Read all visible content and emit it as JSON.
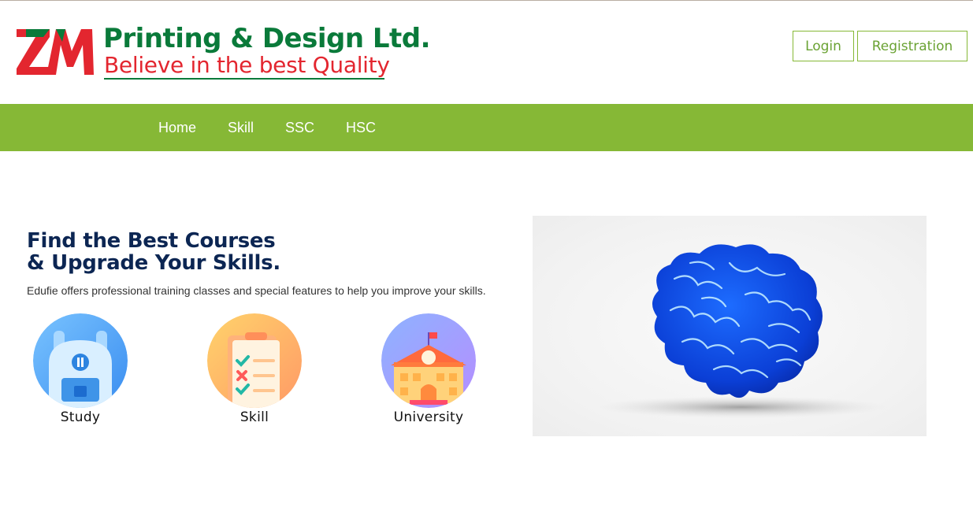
{
  "brand": {
    "logo_mark": "ZM",
    "name": "Printing & Design Ltd.",
    "tagline": "Believe in the best Quality"
  },
  "auth": {
    "login_label": "Login",
    "registration_label": "Registration"
  },
  "nav": {
    "items": [
      {
        "label": "Home"
      },
      {
        "label": "Skill"
      },
      {
        "label": "SSC"
      },
      {
        "label": "HSC"
      }
    ]
  },
  "hero": {
    "title_line1": "Find the Best Courses",
    "title_line2": "& Upgrade Your Skills.",
    "description": "Edufie offers professional training classes and special features to help you improve your skills.",
    "image_icon": "brain-icon"
  },
  "features": [
    {
      "label": "Study",
      "icon": "backpack-icon"
    },
    {
      "label": "Skill",
      "icon": "checklist-icon"
    },
    {
      "label": "University",
      "icon": "university-building-icon"
    }
  ],
  "colors": {
    "brand_green": "#0a7a3a",
    "brand_red": "#e3262f",
    "nav_green": "#86b836",
    "heading_navy": "#0c2653"
  }
}
